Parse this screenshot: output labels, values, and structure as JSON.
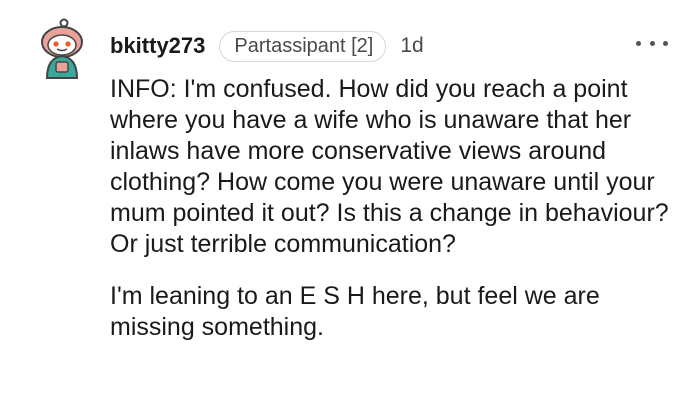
{
  "comment": {
    "username": "bkitty273",
    "flair": "Partassipant [2]",
    "age": "1d",
    "paragraphs": [
      "INFO: I'm confused. How did you reach a point where you have a wife who is unaware that her inlaws have more conservative views around clothing? How come you were unaware until your mum pointed it out? Is this a change in behaviour? Or just terrible communication?",
      "I'm leaning to an E S H here, but feel we are missing something."
    ]
  },
  "icons": {
    "avatar": "snoo-avatar-icon",
    "more": "more-options-icon"
  },
  "colors": {
    "text": "#1a1a1b",
    "meta": "#4a4a4a",
    "flair_border": "#d6d6d6",
    "avatar_hood": "#e9a39b",
    "avatar_jacket": "#3aa89b"
  }
}
